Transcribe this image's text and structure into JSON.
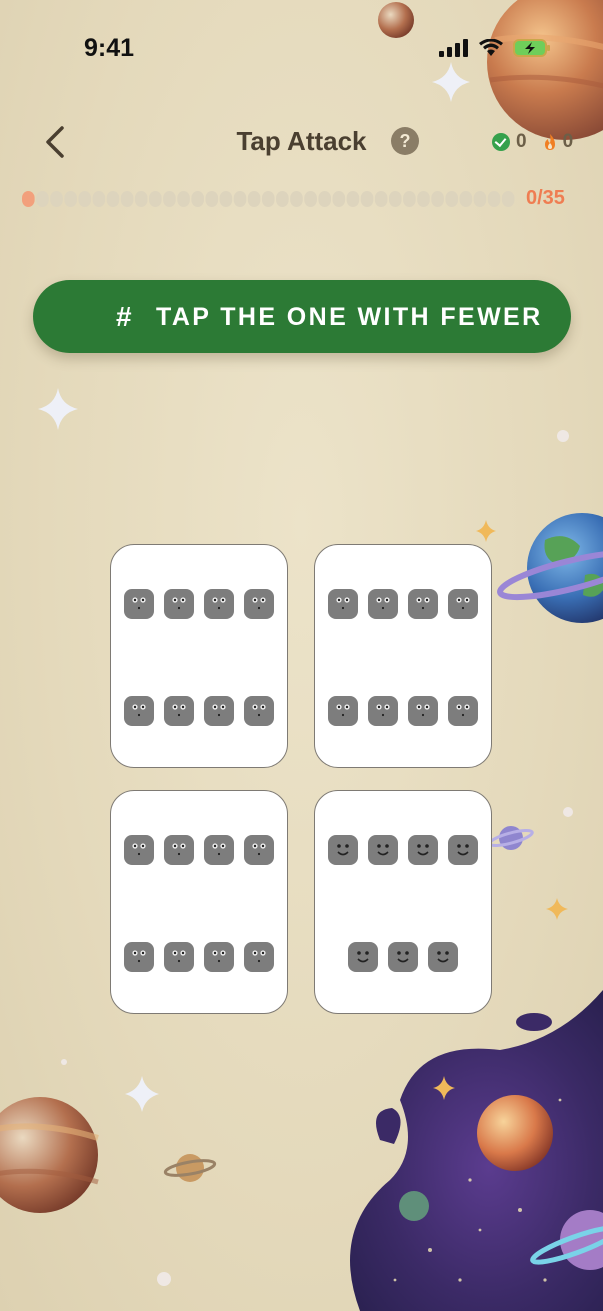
{
  "status_bar": {
    "time": "9:41"
  },
  "header": {
    "title": "Tap Attack",
    "help_label": "?",
    "correct_count": "0",
    "streak_count": "0"
  },
  "progress": {
    "current": 0,
    "total": 35,
    "label": "0/35"
  },
  "banner": {
    "hash": "#",
    "instruction": "TAP THE ONE WITH FEWER"
  },
  "cards": [
    {
      "id": "card-1",
      "faces": 8,
      "expression": "neutral"
    },
    {
      "id": "card-2",
      "faces": 8,
      "expression": "neutral"
    },
    {
      "id": "card-3",
      "faces": 8,
      "expression": "neutral"
    },
    {
      "id": "card-4",
      "faces": 7,
      "expression": "smile"
    }
  ],
  "colors": {
    "banner": "#2c7a35",
    "progress_accent": "#ef7d52",
    "background": "#e6dcc0"
  }
}
